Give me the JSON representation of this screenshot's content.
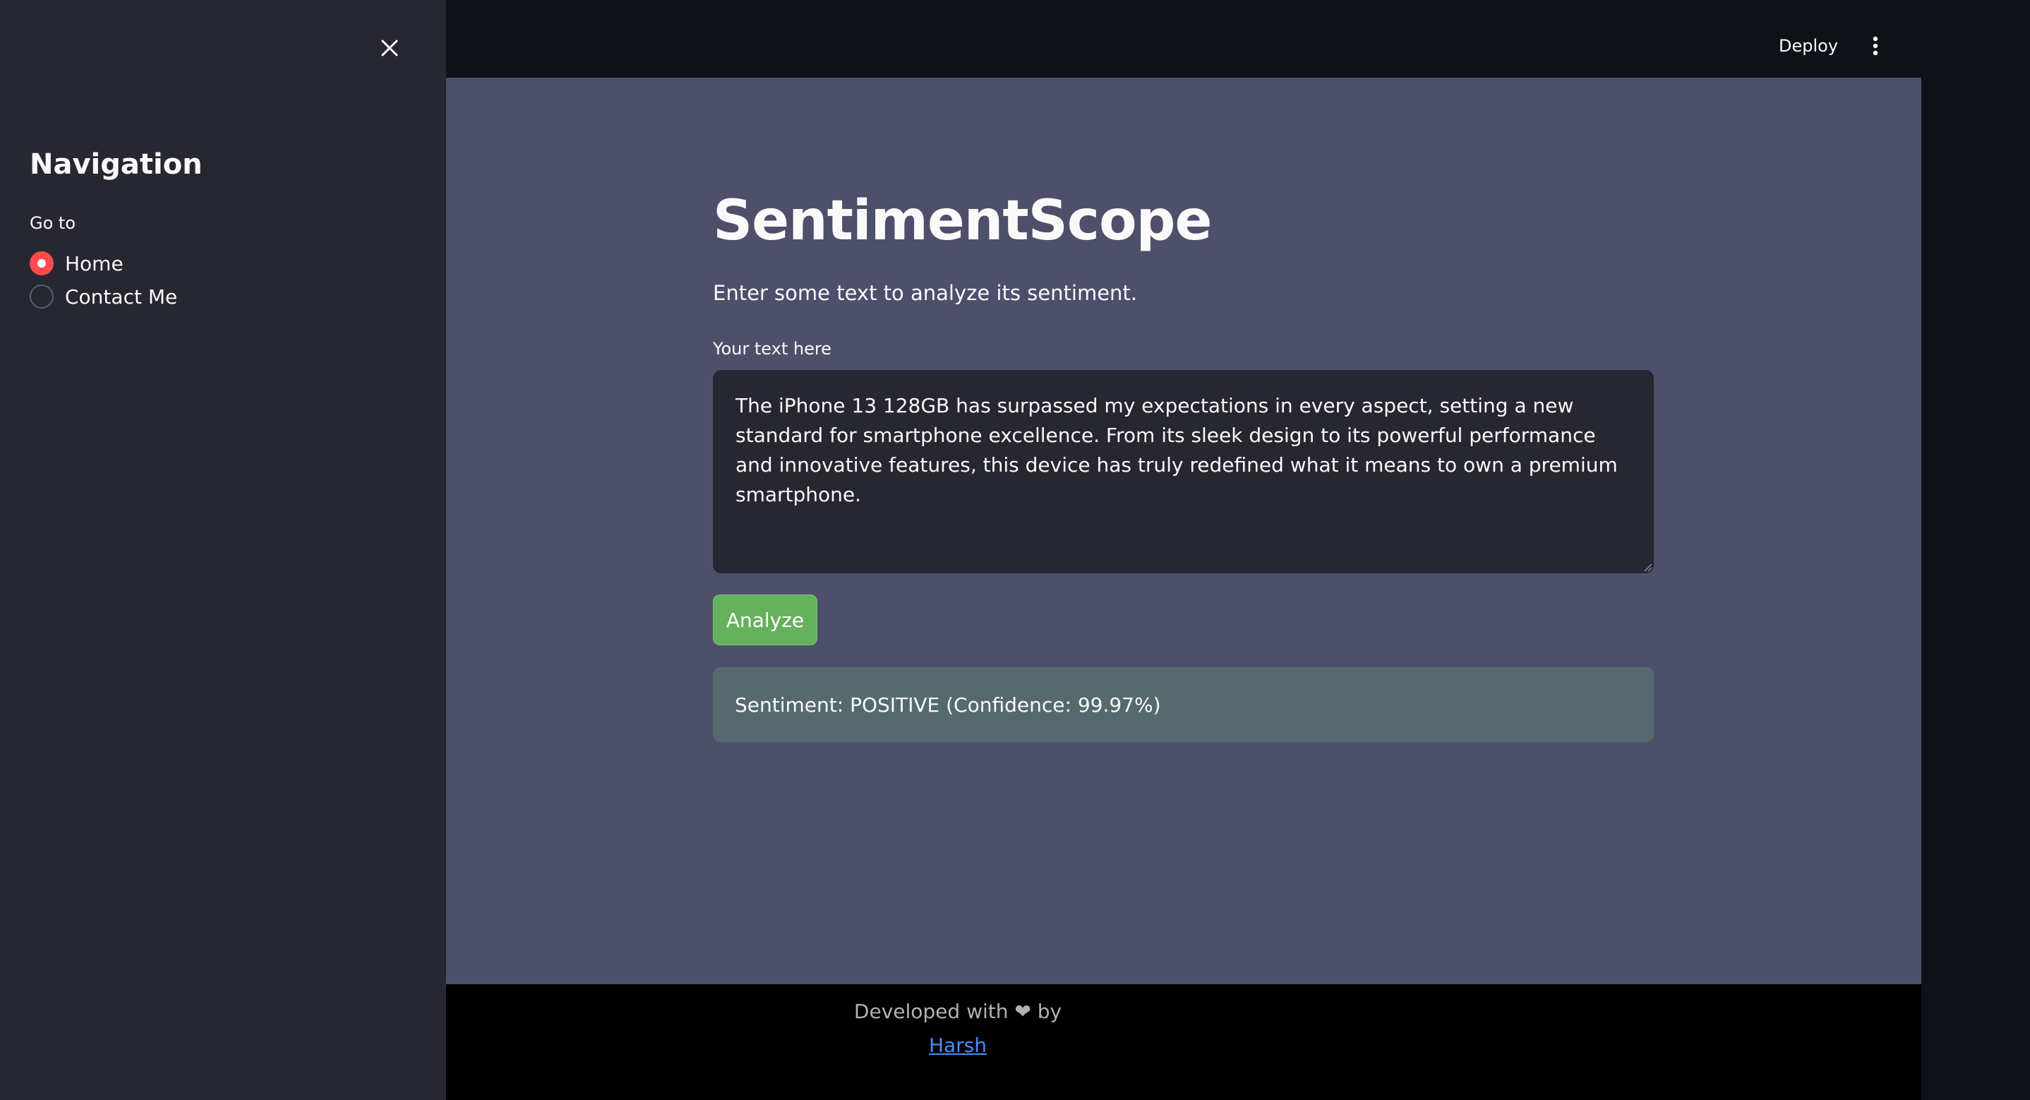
{
  "sidebar": {
    "close_icon": "close-icon",
    "title": "Navigation",
    "radio_group_label": "Go to",
    "options": [
      {
        "label": "Home",
        "selected": true
      },
      {
        "label": "Contact Me",
        "selected": false
      }
    ],
    "accent_color": "#ff4b4b"
  },
  "header": {
    "deploy_label": "Deploy",
    "menu_icon": "kebab-menu-icon"
  },
  "main": {
    "title": "SentimentScope",
    "subtitle": "Enter some text to analyze its sentiment.",
    "input_label": "Your text here",
    "input_value": "The iPhone 13 128GB has surpassed my expectations in every aspect, setting a new standard for smartphone excellence. From its sleek design to its powerful performance and innovative features, this device has truly redefined what it means to own a premium smartphone.",
    "analyze_label": "Analyze",
    "result_text": "Sentiment: POSITIVE (Confidence: 99.97%)"
  },
  "footer": {
    "text": "Developed with ❤ by",
    "link_text": "Harsh"
  },
  "colors": {
    "sidebar_bg": "#262730",
    "main_bg": "#4e4f6b",
    "button_bg": "#66b15c",
    "result_bg": "#566a6e",
    "link": "#4c8bf5"
  }
}
